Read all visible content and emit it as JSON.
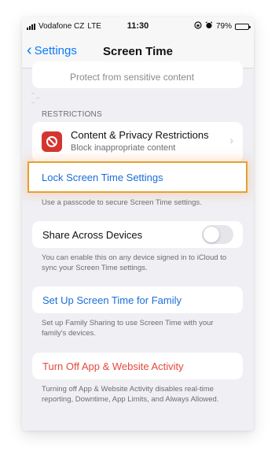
{
  "status_bar": {
    "carrier": "Vodafone CZ",
    "network": "LTE",
    "time": "11:30",
    "battery": "79%",
    "battery_level": 0.79
  },
  "nav": {
    "back_label": "Settings",
    "title": "Screen Time"
  },
  "partial_row": {
    "text": "Protect from sensitive content"
  },
  "restrictions": {
    "header": "RESTRICTIONS",
    "title": "Content & Privacy Restrictions",
    "subtitle": "Block inappropriate content",
    "icon_color": "#d3362f"
  },
  "lock_settings": {
    "label": "Lock Screen Time Settings",
    "footnote": "Use a passcode to secure Screen Time settings.",
    "highlight_color": "#e3a22d"
  },
  "share_devices": {
    "label": "Share Across Devices",
    "enabled": false,
    "footnote": "You can enable this on any device signed in to iCloud to sync your Screen Time settings."
  },
  "family": {
    "label": "Set Up Screen Time for Family",
    "footnote": "Set up Family Sharing to use Screen Time with your family's devices."
  },
  "turn_off": {
    "label": "Turn Off App & Website Activity",
    "footnote": "Turning off App & Website Activity disables real-time reporting, Downtime, App Limits, and Always Allowed."
  },
  "colors": {
    "accent_blue": "#0a7aff",
    "destructive_red": "#e5483c",
    "background": "#efeff4"
  }
}
